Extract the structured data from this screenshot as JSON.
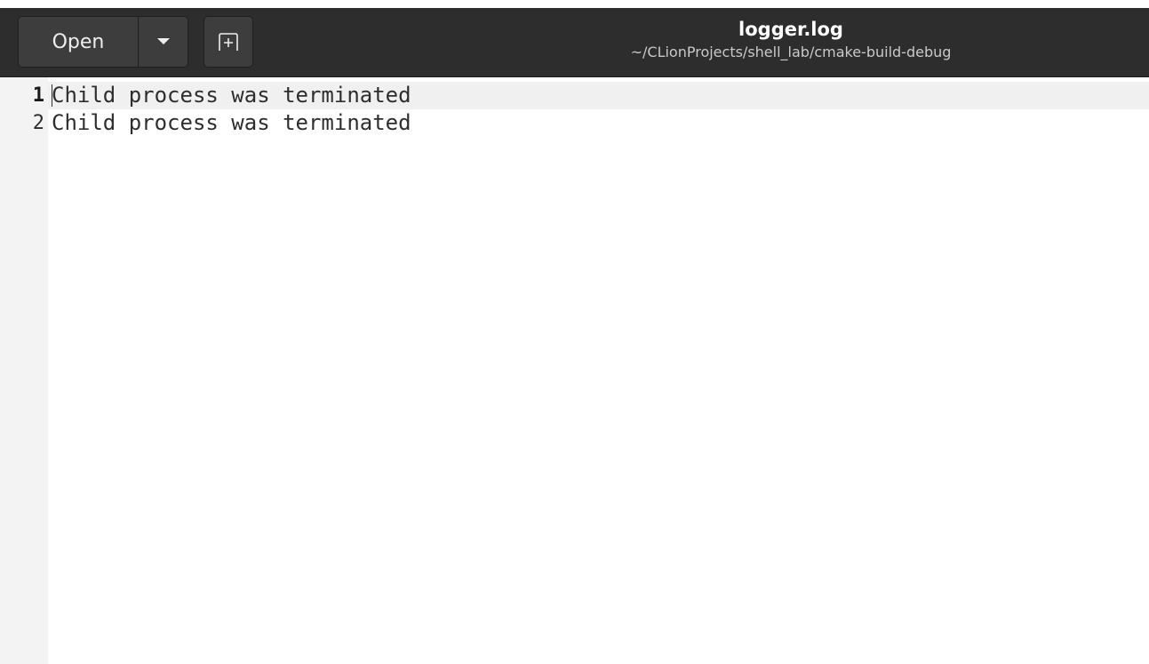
{
  "header": {
    "open_label": "Open",
    "title": "logger.log",
    "subtitle": "~/CLionProjects/shell_lab/cmake-build-debug"
  },
  "icons": {
    "dropdown": "chevron-down-icon",
    "new_tab": "new-tab-icon"
  },
  "editor": {
    "lines": [
      {
        "number": "1",
        "text": "Child process was terminated"
      },
      {
        "number": "2",
        "text": "Child process was terminated"
      }
    ]
  },
  "colors": {
    "headerbar": "#2d2d2d",
    "button": "#3d3d3d",
    "current_line": "#f0f0f0"
  }
}
